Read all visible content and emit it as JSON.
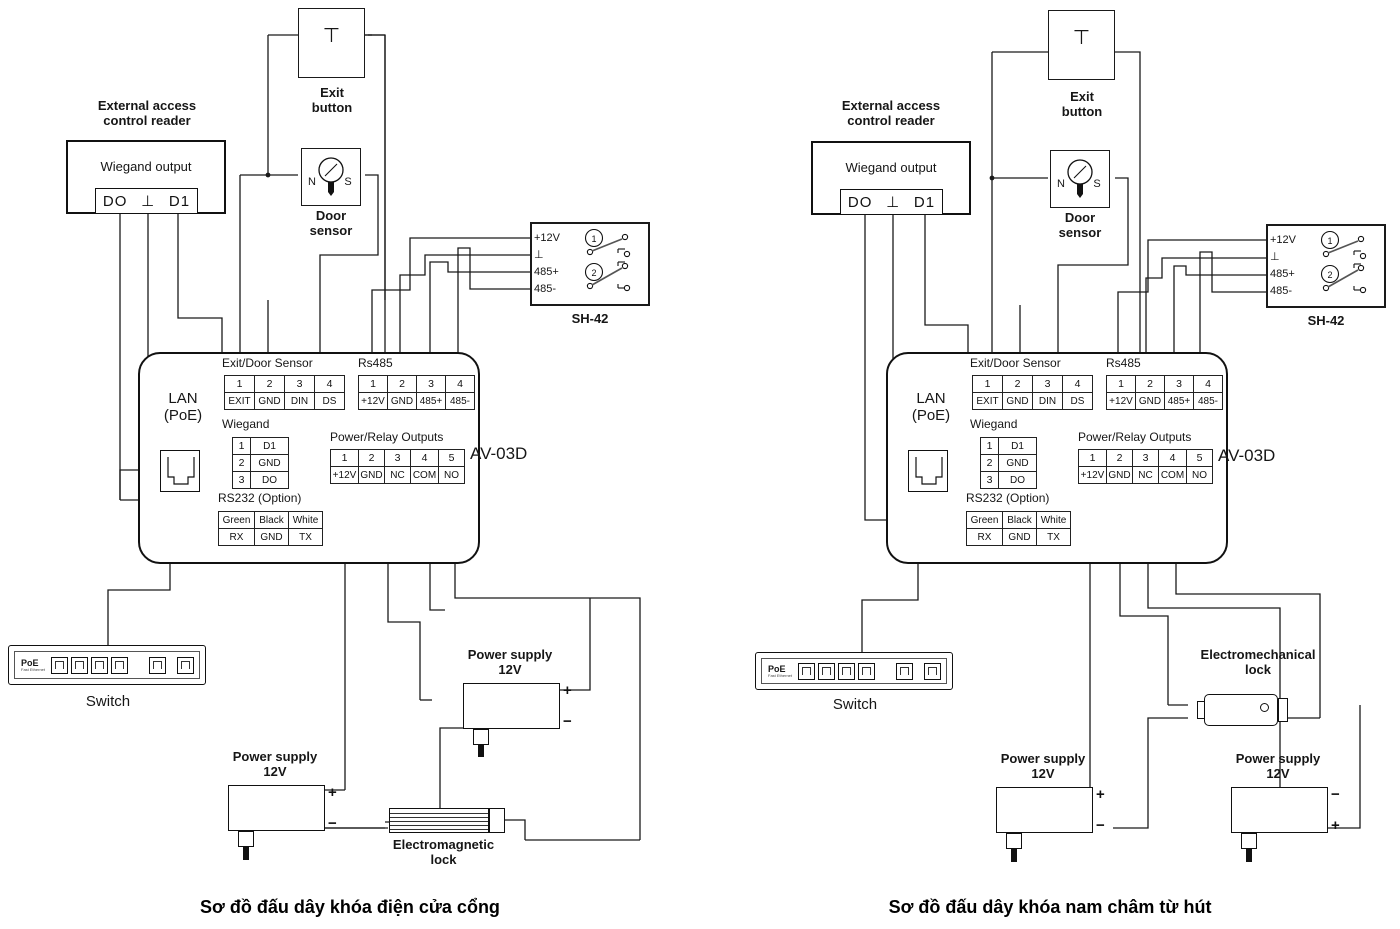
{
  "diagrams": [
    {
      "id": "left",
      "caption": "Sơ đồ đấu dây khóa điện cửa cổng",
      "reader": {
        "title": "External access\ncontrol reader",
        "subtitle": "Wiegand output",
        "terminals": [
          "DO",
          "⊥",
          "D1"
        ]
      },
      "exit_button": {
        "label": "Exit\nbutton"
      },
      "door_sensor": {
        "label": "Door\nsensor",
        "pole_n": "N",
        "pole_s": "S"
      },
      "sh42": {
        "name": "SH-42",
        "terminals": [
          "+12V",
          "⊥",
          "485+",
          "485-"
        ],
        "relays": [
          "1",
          "2"
        ]
      },
      "controller": {
        "model": "AV-03D",
        "lan": {
          "label": "LAN\n(PoE)"
        },
        "exit_door_sensor": {
          "title": "Exit/Door Sensor",
          "numbers": [
            "1",
            "2",
            "3",
            "4"
          ],
          "names": [
            "EXIT",
            "GND",
            "DIN",
            "DS"
          ]
        },
        "rs485": {
          "title": "Rs485",
          "numbers": [
            "1",
            "2",
            "3",
            "4"
          ],
          "names": [
            "+12V",
            "GND",
            "485+",
            "485-"
          ]
        },
        "wiegand": {
          "title": "Wiegand",
          "numbers": [
            "1",
            "2",
            "3"
          ],
          "names": [
            "D1",
            "GND",
            "DO"
          ]
        },
        "rs232": {
          "title": "RS232 (Option)",
          "colors": [
            "Green",
            "Black",
            "White"
          ],
          "names": [
            "RX",
            "GND",
            "TX"
          ]
        },
        "power_relay": {
          "title": "Power/Relay Outputs",
          "numbers": [
            "1",
            "2",
            "3",
            "4",
            "5"
          ],
          "names": [
            "+12V",
            "GND",
            "NC",
            "COM",
            "NO"
          ]
        }
      },
      "switch": {
        "label": "Switch",
        "badge": "PoE",
        "badge_sub": "Fast Ethernet",
        "ports": 4,
        "uplinks": 2
      },
      "psu_a": {
        "label": "Power supply\n12V",
        "top_sign": "+",
        "bottom_sign": "−"
      },
      "psu_b": {
        "label": "Power supply\n12V",
        "top_sign": "+",
        "bottom_sign": "−"
      },
      "lock": {
        "type": "electromagnetic",
        "label": "Electromagnetic\nlock"
      }
    },
    {
      "id": "right",
      "caption": "Sơ đồ đấu dây khóa nam châm từ hút",
      "reader": {
        "title": "External access\ncontrol reader",
        "subtitle": "Wiegand output",
        "terminals": [
          "DO",
          "⊥",
          "D1"
        ]
      },
      "exit_button": {
        "label": "Exit\nbutton"
      },
      "door_sensor": {
        "label": "Door\nsensor",
        "pole_n": "N",
        "pole_s": "S"
      },
      "sh42": {
        "name": "SH-42",
        "terminals": [
          "+12V",
          "⊥",
          "485+",
          "485-"
        ],
        "relays": [
          "1",
          "2"
        ]
      },
      "controller": {
        "model": "AV-03D",
        "lan": {
          "label": "LAN\n(PoE)"
        },
        "exit_door_sensor": {
          "title": "Exit/Door Sensor",
          "numbers": [
            "1",
            "2",
            "3",
            "4"
          ],
          "names": [
            "EXIT",
            "GND",
            "DIN",
            "DS"
          ]
        },
        "rs485": {
          "title": "Rs485",
          "numbers": [
            "1",
            "2",
            "3",
            "4"
          ],
          "names": [
            "+12V",
            "GND",
            "485+",
            "485-"
          ]
        },
        "wiegand": {
          "title": "Wiegand",
          "numbers": [
            "1",
            "2",
            "3"
          ],
          "names": [
            "D1",
            "GND",
            "DO"
          ]
        },
        "rs232": {
          "title": "RS232 (Option)",
          "colors": [
            "Green",
            "Black",
            "White"
          ],
          "names": [
            "RX",
            "GND",
            "TX"
          ]
        },
        "power_relay": {
          "title": "Power/Relay Outputs",
          "numbers": [
            "1",
            "2",
            "3",
            "4",
            "5"
          ],
          "names": [
            "+12V",
            "GND",
            "NC",
            "COM",
            "NO"
          ]
        }
      },
      "switch": {
        "label": "Switch",
        "badge": "PoE",
        "badge_sub": "Fast Ethernet",
        "ports": 4,
        "uplinks": 2
      },
      "psu_a": {
        "label": "Power supply\n12V",
        "top_sign": "+",
        "bottom_sign": "−"
      },
      "psu_b": {
        "label": "Power supply\n12V",
        "top_sign": "−",
        "bottom_sign": "+"
      },
      "lock": {
        "type": "electromechanical",
        "label": "Electromechanical\nlock"
      }
    }
  ],
  "colors": {
    "line": "#1a1a1a",
    "text": "#111111",
    "background": "#ffffff"
  }
}
